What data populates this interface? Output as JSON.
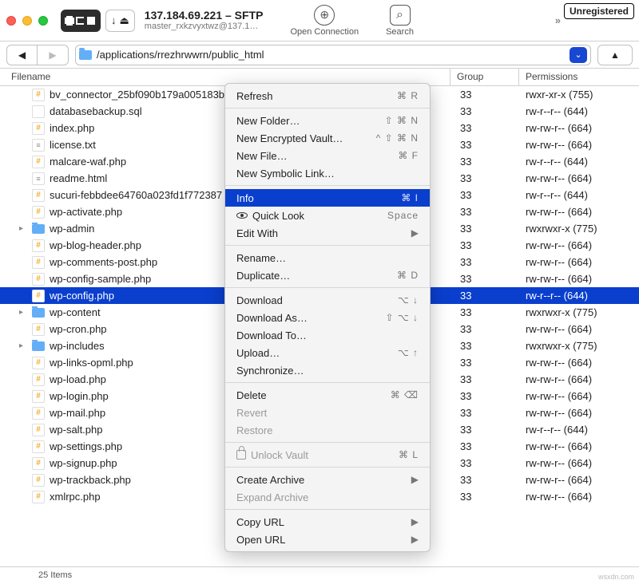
{
  "titlebar": {
    "host": "137.184.69.221 – SFTP",
    "sub": "master_rxkzvyxtwz@137.1…",
    "open_connection": "Open Connection",
    "search": "Search",
    "unregistered": "Unregistered"
  },
  "nav": {
    "path": "/applications/rrezhrwwrn/public_html"
  },
  "columns": {
    "name": "Filename",
    "group": "Group",
    "perm": "Permissions"
  },
  "rows": [
    {
      "icon": "php",
      "name": "bv_connector_25bf090b179a005183b",
      "group": "33",
      "perm": "rwxr-xr-x (755)"
    },
    {
      "icon": "sql",
      "name": "databasebackup.sql",
      "group": "33",
      "perm": "rw-r--r-- (644)"
    },
    {
      "icon": "php",
      "name": "index.php",
      "group": "33",
      "perm": "rw-rw-r-- (664)"
    },
    {
      "icon": "txt",
      "name": "license.txt",
      "group": "33",
      "perm": "rw-rw-r-- (664)"
    },
    {
      "icon": "php",
      "name": "malcare-waf.php",
      "group": "33",
      "perm": "rw-r--r-- (644)"
    },
    {
      "icon": "txt",
      "name": "readme.html",
      "group": "33",
      "perm": "rw-rw-r-- (664)"
    },
    {
      "icon": "php",
      "name": "sucuri-febbdee64760a023fd1f772387",
      "group": "33",
      "perm": "rw-r--r-- (644)"
    },
    {
      "icon": "php",
      "name": "wp-activate.php",
      "group": "33",
      "perm": "rw-rw-r-- (664)"
    },
    {
      "icon": "fld",
      "name": "wp-admin",
      "disclosure": true,
      "group": "33",
      "perm": "rwxrwxr-x (775)"
    },
    {
      "icon": "php",
      "name": "wp-blog-header.php",
      "group": "33",
      "perm": "rw-rw-r-- (664)"
    },
    {
      "icon": "php",
      "name": "wp-comments-post.php",
      "group": "33",
      "perm": "rw-rw-r-- (664)"
    },
    {
      "icon": "php",
      "name": "wp-config-sample.php",
      "group": "33",
      "perm": "rw-rw-r-- (664)"
    },
    {
      "icon": "php",
      "name": "wp-config.php",
      "selected": true,
      "group": "33",
      "perm": "rw-r--r-- (644)"
    },
    {
      "icon": "fld",
      "name": "wp-content",
      "disclosure": true,
      "group": "33",
      "perm": "rwxrwxr-x (775)"
    },
    {
      "icon": "php",
      "name": "wp-cron.php",
      "group": "33",
      "perm": "rw-rw-r-- (664)"
    },
    {
      "icon": "fld",
      "name": "wp-includes",
      "disclosure": true,
      "group": "33",
      "perm": "rwxrwxr-x (775)"
    },
    {
      "icon": "php",
      "name": "wp-links-opml.php",
      "group": "33",
      "perm": "rw-rw-r-- (664)"
    },
    {
      "icon": "php",
      "name": "wp-load.php",
      "group": "33",
      "perm": "rw-rw-r-- (664)"
    },
    {
      "icon": "php",
      "name": "wp-login.php",
      "group": "33",
      "perm": "rw-rw-r-- (664)"
    },
    {
      "icon": "php",
      "name": "wp-mail.php",
      "group": "33",
      "perm": "rw-rw-r-- (664)"
    },
    {
      "icon": "php",
      "name": "wp-salt.php",
      "group": "33",
      "perm": "rw-r--r-- (644)"
    },
    {
      "icon": "php",
      "name": "wp-settings.php",
      "group": "33",
      "perm": "rw-rw-r-- (664)"
    },
    {
      "icon": "php",
      "name": "wp-signup.php",
      "group": "33",
      "perm": "rw-rw-r-- (664)"
    },
    {
      "icon": "php",
      "name": "wp-trackback.php",
      "group": "33",
      "perm": "rw-rw-r-- (664)"
    },
    {
      "icon": "php",
      "name": "xmlrpc.php",
      "group": "33",
      "perm": "rw-rw-r-- (664)"
    }
  ],
  "footer": {
    "count": "25 Items"
  },
  "menu": {
    "refresh": "Refresh",
    "refresh_sc": "⌘ R",
    "new_folder": "New Folder…",
    "new_folder_sc": "⇧ ⌘ N",
    "new_vault": "New Encrypted Vault…",
    "new_vault_sc": "^ ⇧ ⌘ N",
    "new_file": "New File…",
    "new_file_sc": "⌘ F",
    "new_symlink": "New Symbolic Link…",
    "info": "Info",
    "info_sc": "⌘ I",
    "quicklook": "Quick Look",
    "quicklook_sc": "Space",
    "edit_with": "Edit With",
    "rename": "Rename…",
    "duplicate": "Duplicate…",
    "duplicate_sc": "⌘ D",
    "download": "Download",
    "download_sc": "⌥ ↓",
    "download_as": "Download As…",
    "download_as_sc": "⇧ ⌥ ↓",
    "download_to": "Download To…",
    "upload": "Upload…",
    "upload_sc": "⌥ ↑",
    "sync": "Synchronize…",
    "delete": "Delete",
    "delete_sc": "⌘ ⌫",
    "revert": "Revert",
    "restore": "Restore",
    "unlock": "Unlock Vault",
    "unlock_sc": "⌘ L",
    "create_archive": "Create Archive",
    "expand_archive": "Expand Archive",
    "copy_url": "Copy URL",
    "open_url": "Open URL"
  },
  "watermark": "wsxdn.com"
}
